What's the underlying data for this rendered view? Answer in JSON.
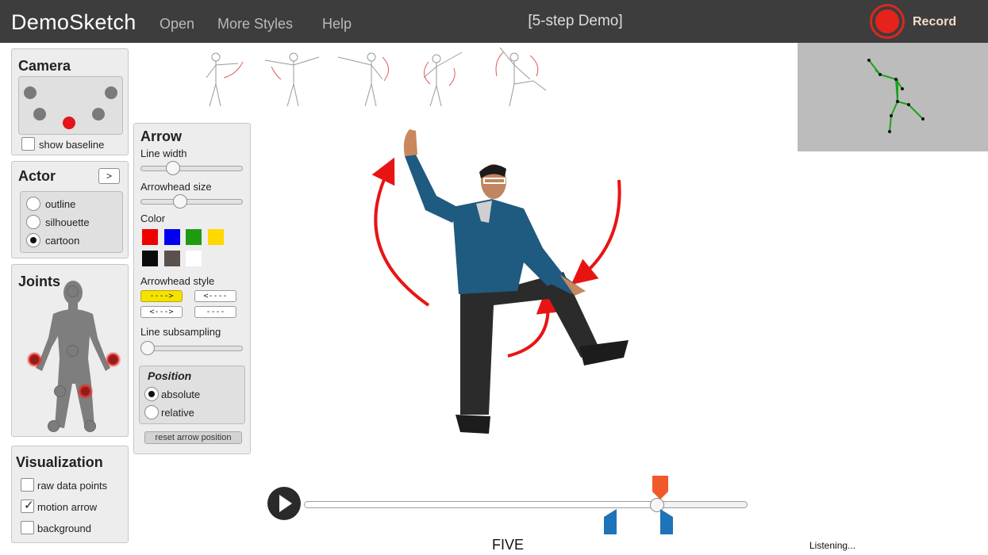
{
  "app": {
    "brand": "DemoSketch",
    "demo_title": "[5-step Demo]",
    "record_label": "Record"
  },
  "menu": {
    "open": "Open",
    "more_styles": "More Styles",
    "help": "Help"
  },
  "camera": {
    "title": "Camera",
    "show_baseline": "show baseline",
    "show_baseline_checked": false
  },
  "actor": {
    "title": "Actor",
    "expand_label": ">",
    "options": [
      "outline",
      "silhouette",
      "cartoon"
    ],
    "selected": "cartoon"
  },
  "joints": {
    "title": "Joints"
  },
  "visualization": {
    "title": "Visualization",
    "options": [
      {
        "label": "raw data points",
        "checked": false
      },
      {
        "label": "motion arrow",
        "checked": true
      },
      {
        "label": "background",
        "checked": false
      }
    ]
  },
  "arrow": {
    "title": "Arrow",
    "line_width_label": "Line width",
    "line_width_value": 0.3,
    "arrowhead_size_label": "Arrowhead size",
    "arrowhead_size_value": 0.37,
    "color_label": "Color",
    "colors": [
      "#ee0000",
      "#0000ee",
      "#1f9b12",
      "#ffd800",
      "#0b0b0b",
      "#5a504c",
      "#ffffff"
    ],
    "arrowhead_style_label": "Arrowhead style",
    "styles": [
      "---->",
      "<----",
      "<--->",
      "----"
    ],
    "selected_style": "---->",
    "line_subsampling_label": "Line subsampling",
    "line_subsampling_value": 0.0,
    "position_title": "Position",
    "position_options": [
      "absolute",
      "relative"
    ],
    "position_selected": "absolute",
    "reset_label": "reset arrow position"
  },
  "playback": {
    "progress": 0.8,
    "step_label": "FIVE",
    "status": "Listening..."
  }
}
